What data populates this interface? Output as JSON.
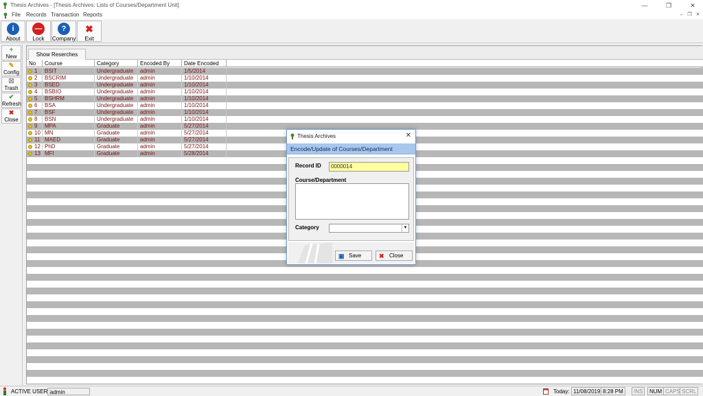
{
  "window": {
    "title": "Thesis Archives - [Thesis Archives: Lists of Courses/Department Unit]",
    "minimize": "—",
    "restore": "❐",
    "close": "✕"
  },
  "menu": {
    "items": [
      "File",
      "Records",
      "Transaction",
      "Reports"
    ],
    "mdi_controls": [
      "–",
      "❐",
      "✕"
    ]
  },
  "toolbar": {
    "buttons": [
      {
        "label": "About",
        "icon": "info-icon",
        "glyph": "i",
        "color": "#1b5fb3"
      },
      {
        "label": "Lock",
        "icon": "lock-icon",
        "glyph": "—",
        "color": "#d22020"
      },
      {
        "label": "Company",
        "icon": "help-icon",
        "glyph": "?",
        "color": "#1b5fb3"
      },
      {
        "label": "Exit",
        "icon": "exit-icon",
        "glyph": "✖",
        "color": "#d22020"
      }
    ]
  },
  "sidebar": {
    "buttons": [
      {
        "label": "New",
        "icon": "plus-icon",
        "glyph": "+",
        "color": "#2e9a2e"
      },
      {
        "label": "Config",
        "icon": "pencil-icon",
        "glyph": "✎",
        "color": "#c99a00"
      },
      {
        "label": "Trash",
        "icon": "trash-icon",
        "glyph": "☒",
        "color": "#777777"
      },
      {
        "label": "Refresh",
        "icon": "check-icon",
        "glyph": "✔",
        "color": "#2e9a2e"
      },
      {
        "label": "Close",
        "icon": "close-icon",
        "glyph": "✖",
        "color": "#d22020"
      }
    ]
  },
  "tab": {
    "label": "Show Reserches"
  },
  "table": {
    "columns": [
      "No",
      "Course",
      "Category",
      "Encoded By",
      "Date Encoded"
    ],
    "rows": [
      [
        "1",
        "BSIT",
        "Undergraduate",
        "admin",
        "1/5/2014"
      ],
      [
        "2",
        "BSCRIM",
        "Undergraduate",
        "admin",
        "1/10/2014"
      ],
      [
        "3",
        "BSED",
        "Undergraduate",
        "admin",
        "1/10/2014"
      ],
      [
        "4",
        "BSBIO",
        "Undergraduate",
        "admin",
        "1/10/2014"
      ],
      [
        "5",
        "BSHRM",
        "Undergraduate",
        "admin",
        "1/10/2014"
      ],
      [
        "6",
        "BSA",
        "Undergraduate",
        "admin",
        "1/10/2014"
      ],
      [
        "7",
        "BSF",
        "Undergraduate",
        "admin",
        "1/10/2014"
      ],
      [
        "8",
        "BSN",
        "Undergraduate",
        "admin",
        "1/10/2014"
      ],
      [
        "9",
        "MPA",
        "Graduate",
        "admin",
        "5/27/2014"
      ],
      [
        "10",
        "MN",
        "Graduate",
        "admin",
        "5/27/2014"
      ],
      [
        "11",
        "MAED",
        "Graduate",
        "admin",
        "5/27/2014"
      ],
      [
        "12",
        "PhD",
        "Graduate",
        "admin",
        "5/27/2014"
      ],
      [
        "13",
        "MFI",
        "Graduate",
        "admin",
        "5/28/2014"
      ]
    ]
  },
  "dialog": {
    "title": "Thesis Archives",
    "close": "✕",
    "header": "Encode/Update of Courses/Department",
    "record_id_label": "Record ID",
    "record_id_value": "0000014",
    "course_label": "Course/Department",
    "course_value": "",
    "category_label": "Category",
    "category_value": "",
    "category_arrow": "▼",
    "save_label": "Save",
    "save_glyph": "▣",
    "close_label": "Close",
    "close_glyph": "✖"
  },
  "status": {
    "active_user_label": "ACTIVE USER :",
    "active_user_value": "admin",
    "today_label": "Today:",
    "date": "11/08/2019",
    "time": "8:28 PM",
    "ins": "INS",
    "num": "NUM",
    "caps": "CAPS",
    "scrl": "SCRL"
  },
  "colors": {
    "row_text": "#7a1414",
    "row_alt": "#b7b7b7",
    "dialog_header": "#a9c6ec",
    "id_field_bg": "#ffff9e"
  }
}
